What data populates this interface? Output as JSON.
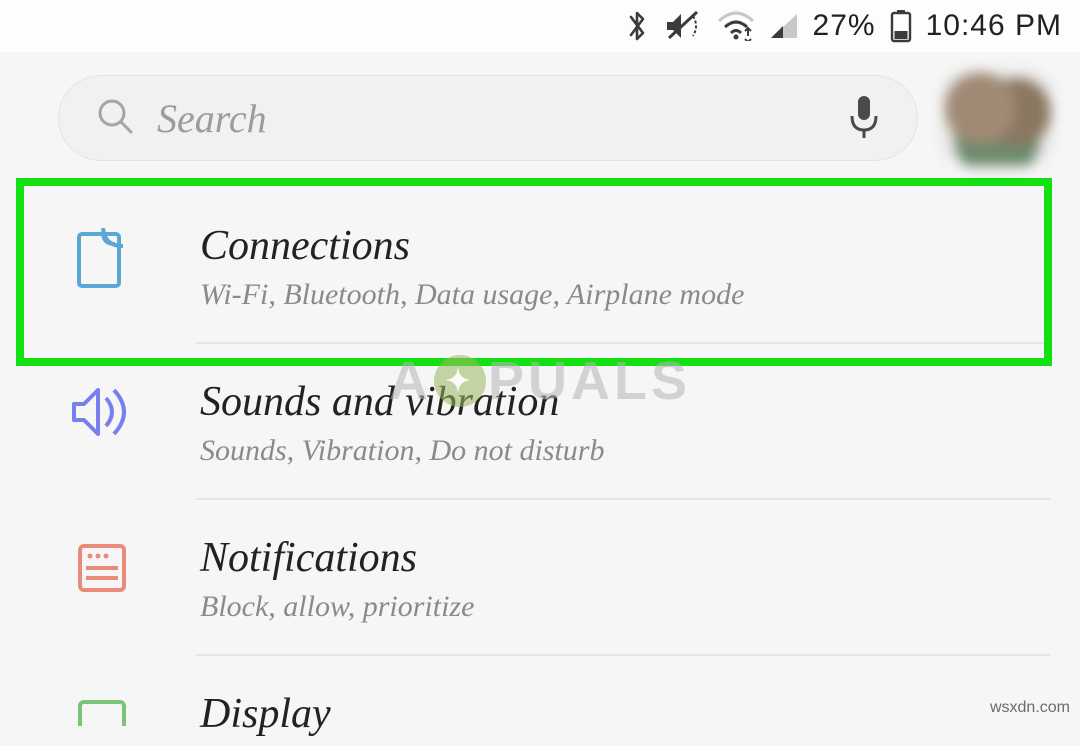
{
  "statusBar": {
    "batteryPercent": "27%",
    "clock": "10:46 PM"
  },
  "search": {
    "placeholder": "Search"
  },
  "settings": {
    "items": [
      {
        "title": "Connections",
        "subtitle": "Wi-Fi, Bluetooth, Data usage, Airplane mode"
      },
      {
        "title": "Sounds and vibration",
        "subtitle": "Sounds, Vibration, Do not disturb"
      },
      {
        "title": "Notifications",
        "subtitle": "Block, allow, prioritize"
      },
      {
        "title": "Display",
        "subtitle": ""
      }
    ]
  },
  "watermark": {
    "left": "A",
    "right": "PUALS"
  },
  "credit": "wsxdn.com"
}
